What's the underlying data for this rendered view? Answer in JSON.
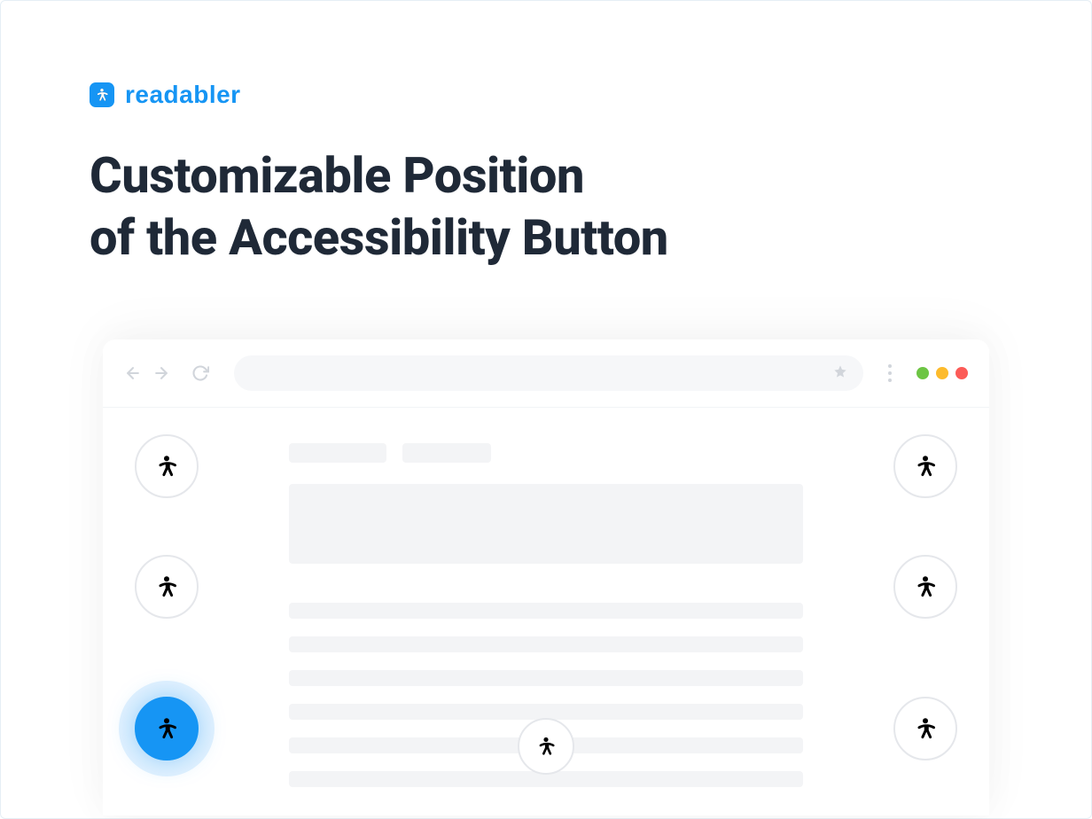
{
  "brand": {
    "name": "readabler",
    "icon": "accessibility-icon"
  },
  "heading": {
    "line1": "Customizable Position",
    "line2": "of the Accessibility Button"
  },
  "browser": {
    "back_icon": "arrow-left",
    "forward_icon": "arrow-right",
    "reload_icon": "reload",
    "star_icon": "star",
    "more_icon": "more-vertical",
    "traffic_lights": [
      "green",
      "yellow",
      "red"
    ]
  },
  "positions": {
    "top_left": {
      "active": false
    },
    "top_right": {
      "active": false
    },
    "mid_left": {
      "active": false
    },
    "mid_right": {
      "active": false
    },
    "bottom_left": {
      "active": true
    },
    "bottom_center": {
      "active": false
    },
    "bottom_right": {
      "active": false
    }
  },
  "colors": {
    "accent": "#1695f4",
    "text": "#1f2937",
    "muted": "#d1d5db"
  }
}
